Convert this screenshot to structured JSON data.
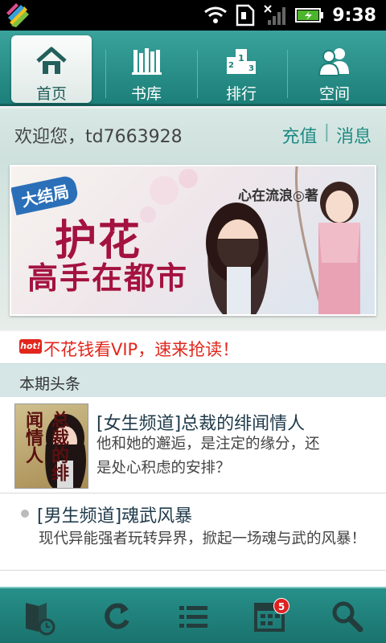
{
  "status_bar": {
    "time": "9:38"
  },
  "nav": {
    "tabs": [
      {
        "label": "首页",
        "icon": "home-icon",
        "active": true
      },
      {
        "label": "书库",
        "icon": "bookshelf-icon",
        "active": false
      },
      {
        "label": "排行",
        "icon": "podium-icon",
        "active": false
      },
      {
        "label": "空间",
        "icon": "users-icon",
        "active": false
      }
    ]
  },
  "greeting": {
    "text": "欢迎您，td7663928",
    "recharge": "充值",
    "separator": "|",
    "messages": "消息"
  },
  "banner": {
    "badge": "大结局",
    "title_line1": "护花",
    "title_line2": "高手在都市",
    "author": "心在流浪◎著"
  },
  "promo": {
    "hot_label": "hot!",
    "text": "不花钱看VIP，速来抢读！"
  },
  "section": {
    "title": "本期头条"
  },
  "articles": [
    {
      "title": "[女生频道]总裁的绯闻情人",
      "desc_line1": "他和她的邂逅，是注定的缘分，还",
      "desc_line2": "是处心积虑的安排？",
      "cover_text": "总裁的绯闻情人"
    },
    {
      "title": "[男生频道]魂武风暴",
      "desc": "现代异能强者玩转异界，掀起一场魂与武的风暴！"
    }
  ],
  "bottom_bar": {
    "buttons": [
      "bookshelf-clock-icon",
      "refresh-icon",
      "list-icon",
      "calendar-icon",
      "search-icon"
    ],
    "notification_count": "5"
  },
  "colors": {
    "accent": "#1d7f79",
    "promo_red": "#e2261c",
    "title_red": "#a4123f"
  }
}
